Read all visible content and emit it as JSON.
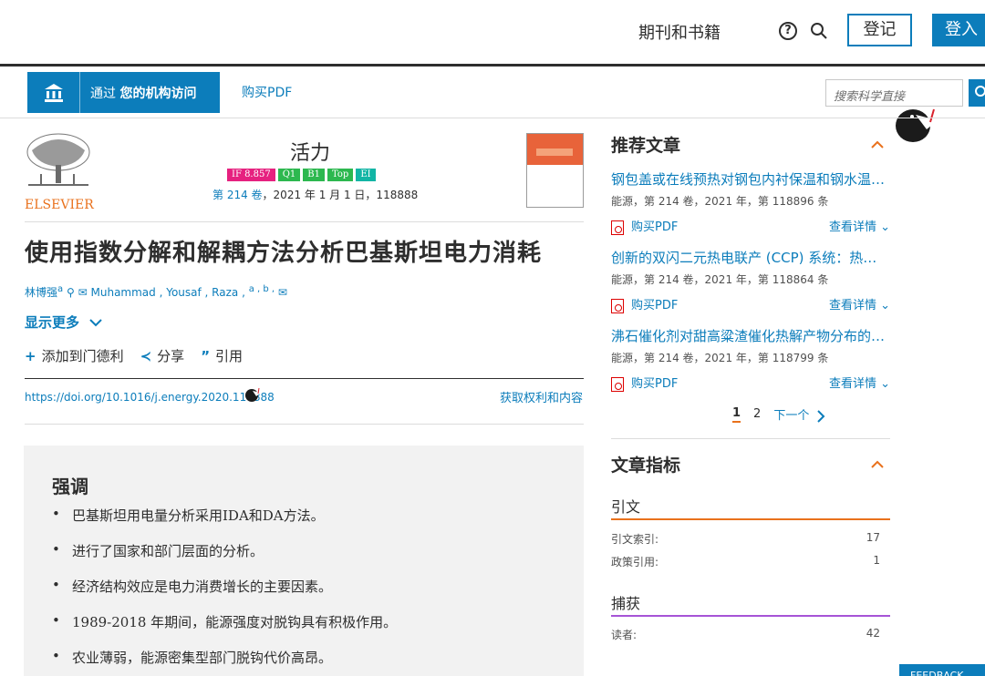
{
  "header": {
    "nav_books": "期刊和书籍",
    "register_label": "登记",
    "login_label": "登入",
    "help_glyph": "?"
  },
  "access": {
    "prefix": "通过",
    "bold": "您的机构访问",
    "buy_pdf": "购买PDF",
    "search_placeholder": "搜索科学直接"
  },
  "journal": {
    "publisher": "ELSEVIER",
    "title": "活力",
    "badges": [
      "IF 8.857",
      "Q1",
      "B1",
      "Top",
      "EI"
    ],
    "volume_link": "第 214 卷",
    "volume_rest": "，2021 年 1 月 1 日，118888"
  },
  "article": {
    "title": "使用指数分解和解耦方法分析巴基斯坦电力消耗",
    "authors": "林博强",
    "author_sup_a": "a",
    "authors_rest": " Muhammad , Yousaf , Raza ,",
    "author_sups": "a , b ,",
    "show_more": "显示更多",
    "actions": {
      "add": "添加到门德利",
      "share": "分享",
      "cite": "引用"
    },
    "doi": "https://doi.org/10.1016/j.energy.2020.118888",
    "rights": "获取权利和内容"
  },
  "highlights": {
    "title": "强调",
    "items": [
      "巴基斯坦用电量分析采用IDA和DA方法。",
      "进行了国家和部门层面的分析。",
      "经济结构效应是电力消费增长的主要因素。",
      "1989-2018 年期间，能源强度对脱钩具有积极作用。",
      "农业薄弱，能源密集型部门脱钩代价高昂。"
    ]
  },
  "recommended": {
    "title": "推荐文章",
    "items": [
      {
        "title": "钢包盖或在线预热对钢包内衬保温和钢水温…",
        "meta": "能源，第 214 卷，2021 年，第 118896 条",
        "pdf": "购买PDF",
        "details": "查看详情"
      },
      {
        "title": "创新的双闪二元热电联产 (CCP) 系统：热力…",
        "meta": "能源，第 214 卷，2021 年，第 118864 条",
        "pdf": "购买PDF",
        "details": "查看详情"
      },
      {
        "title": "沸石催化剂对甜高粱渣催化热解产物分布的…",
        "meta": "能源，第 214 卷，2021 年，第 118799 条",
        "pdf": "购买PDF",
        "details": "查看详情"
      }
    ],
    "pager": {
      "current": "1",
      "page2": "2",
      "next": "下一个"
    }
  },
  "metrics": {
    "title": "文章指标",
    "citations": {
      "head": "引文",
      "index_label": "引文索引:",
      "index_value": "17",
      "policy_label": "政策引用:",
      "policy_value": "1"
    },
    "captures": {
      "head": "捕获",
      "readers_label": "读者:",
      "readers_value": "42"
    }
  },
  "feedback": "FEEDBACK",
  "colors": {
    "brand": "#0c7dbb",
    "accent_orange": "#e9711c",
    "citation_bar": "#e9711c",
    "capture_bar": "#a654d6",
    "if_badge": "#e6217f",
    "q_badge": "#2db84f",
    "ei_badge": "#12b5a5"
  }
}
